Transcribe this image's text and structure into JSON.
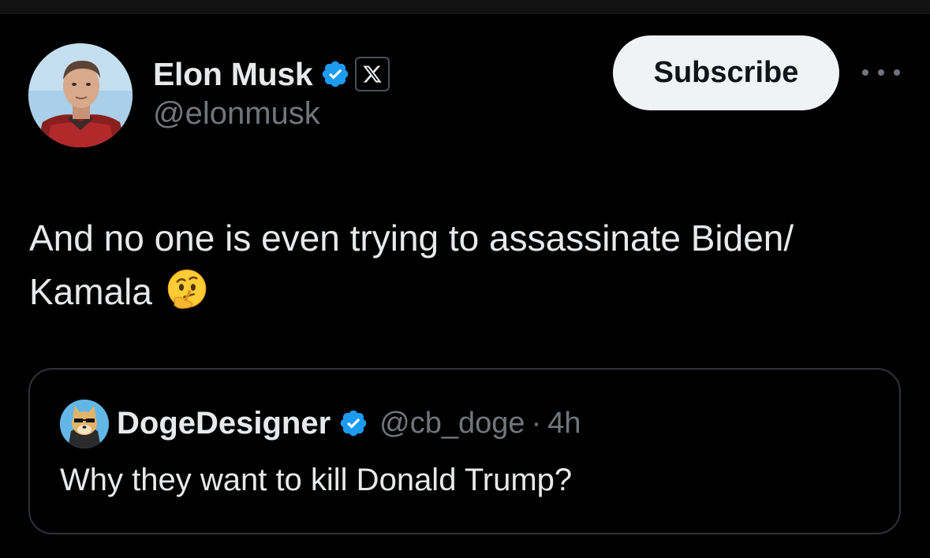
{
  "author": {
    "name": "Elon Musk",
    "handle": "@elonmusk",
    "verified": true,
    "affiliate_badge_icon": "x-logo-icon"
  },
  "actions": {
    "subscribe_label": "Subscribe",
    "more_icon": "more-options-icon"
  },
  "tweet": {
    "text_line1": "And no one is even trying to assassinate Biden/",
    "text_line2": "Kamala",
    "emoji_icon": "thinking-face-icon"
  },
  "quoted_tweet": {
    "author_name": "DogeDesigner",
    "handle": "@cb_doge",
    "separator": "·",
    "time": "4h",
    "verified": true,
    "text": "Why they want to kill Donald Trump?"
  },
  "colors": {
    "background": "#000000",
    "text_primary": "#e7e9ea",
    "text_secondary": "#71767b",
    "verified_blue": "#1d9bf0",
    "subscribe_bg": "#eff3f4",
    "border": "#2f3336"
  }
}
